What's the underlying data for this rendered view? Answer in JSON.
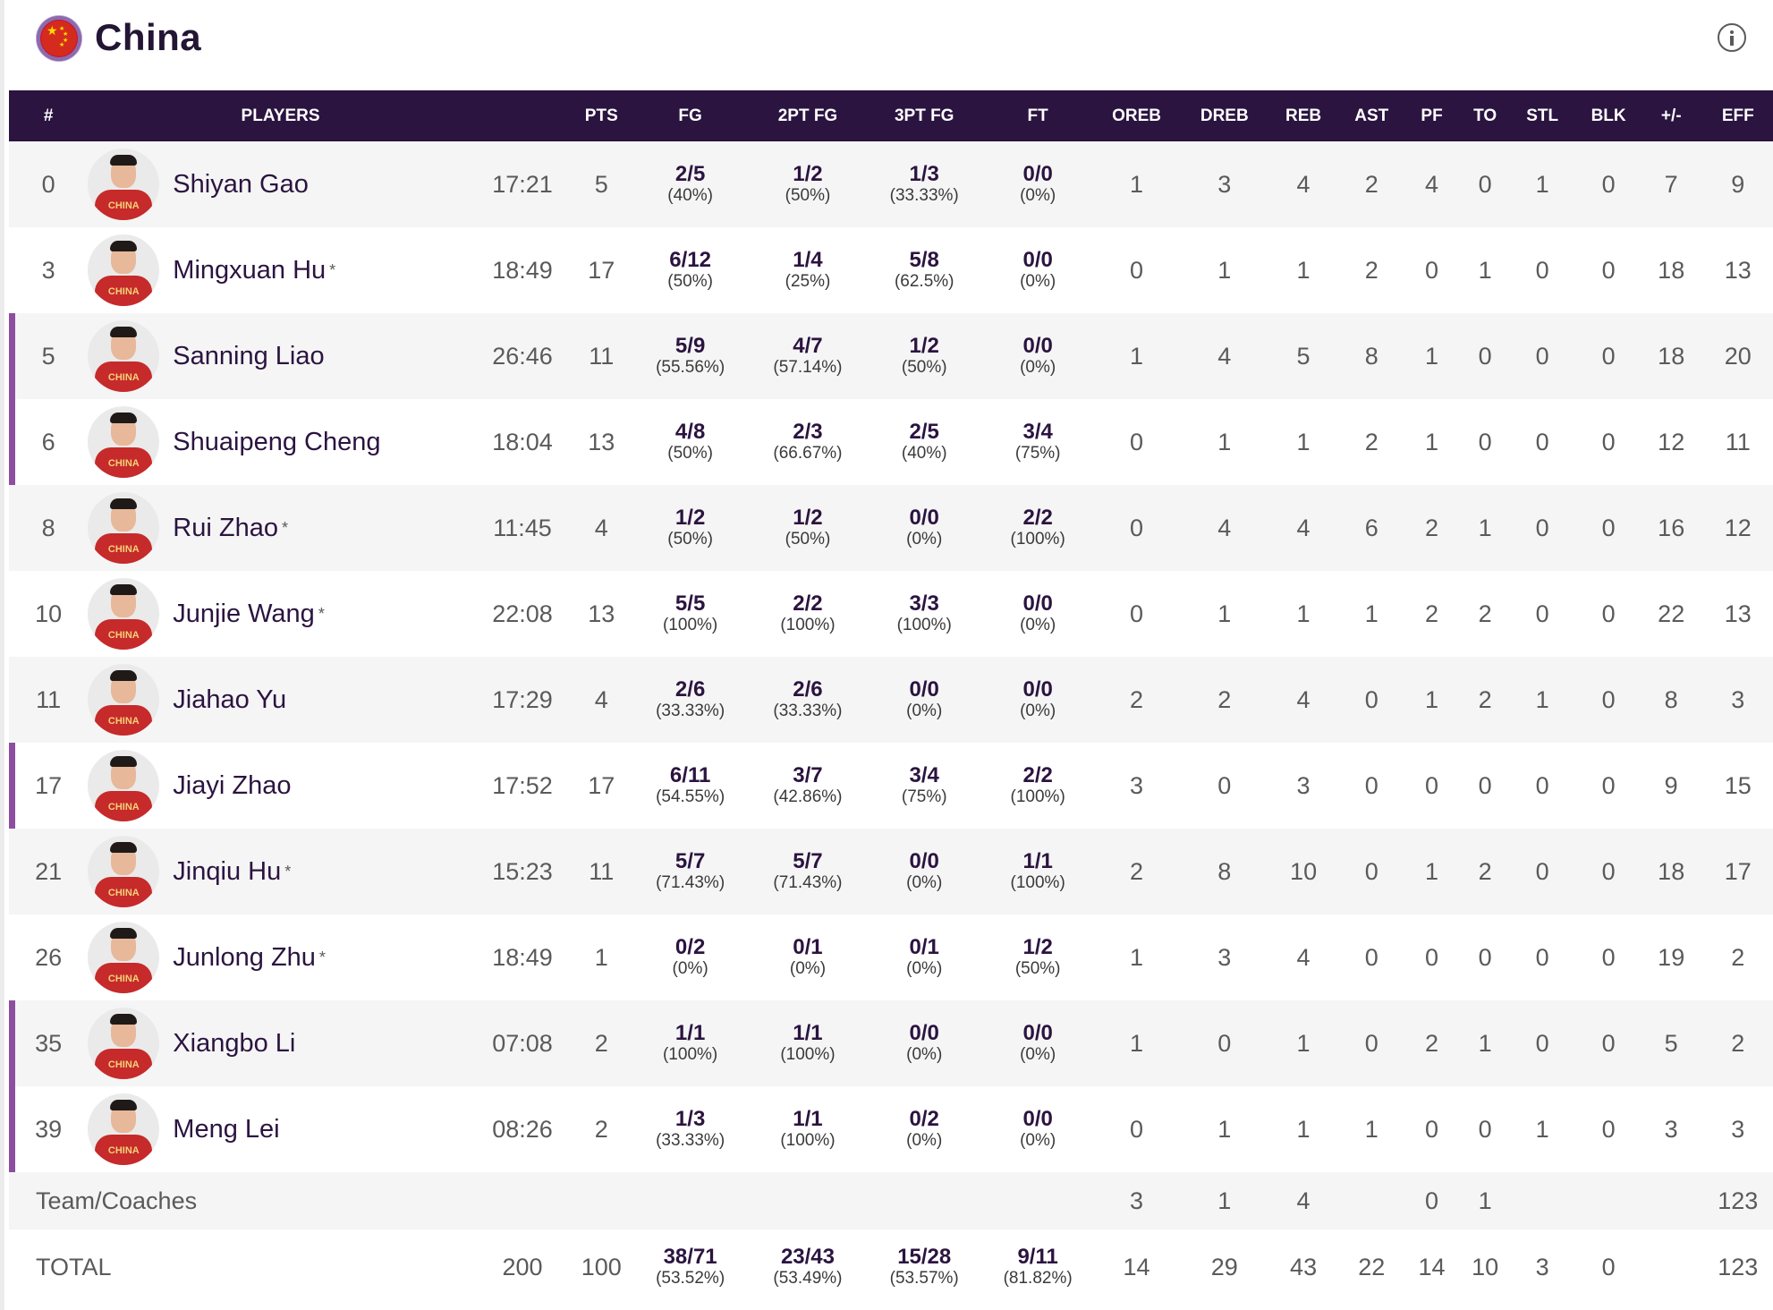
{
  "team": {
    "name": "China",
    "flag_icon": "china-flag-icon",
    "info_icon": "info-icon"
  },
  "columns": [
    "#",
    "PLAYERS",
    "",
    "PTS",
    "FG",
    "2PT FG",
    "3PT FG",
    "FT",
    "OREB",
    "DREB",
    "REB",
    "AST",
    "PF",
    "TO",
    "STL",
    "BLK",
    "+/-",
    "EFF"
  ],
  "players": [
    {
      "num": "0",
      "name": "Shiyan Gao",
      "star": "",
      "starter": false,
      "min": "17:21",
      "pts": "5",
      "fg": [
        "2/5",
        "(40%)"
      ],
      "fg2": [
        "1/2",
        "(50%)"
      ],
      "fg3": [
        "1/3",
        "(33.33%)"
      ],
      "ft": [
        "0/0",
        "(0%)"
      ],
      "oreb": "1",
      "dreb": "3",
      "reb": "4",
      "ast": "2",
      "pf": "4",
      "to": "0",
      "stl": "1",
      "blk": "0",
      "pm": "7",
      "eff": "9"
    },
    {
      "num": "3",
      "name": "Mingxuan Hu",
      "star": "*",
      "starter": false,
      "min": "18:49",
      "pts": "17",
      "fg": [
        "6/12",
        "(50%)"
      ],
      "fg2": [
        "1/4",
        "(25%)"
      ],
      "fg3": [
        "5/8",
        "(62.5%)"
      ],
      "ft": [
        "0/0",
        "(0%)"
      ],
      "oreb": "0",
      "dreb": "1",
      "reb": "1",
      "ast": "2",
      "pf": "0",
      "to": "1",
      "stl": "0",
      "blk": "0",
      "pm": "18",
      "eff": "13"
    },
    {
      "num": "5",
      "name": "Sanning Liao",
      "star": "",
      "starter": true,
      "min": "26:46",
      "pts": "11",
      "fg": [
        "5/9",
        "(55.56%)"
      ],
      "fg2": [
        "4/7",
        "(57.14%)"
      ],
      "fg3": [
        "1/2",
        "(50%)"
      ],
      "ft": [
        "0/0",
        "(0%)"
      ],
      "oreb": "1",
      "dreb": "4",
      "reb": "5",
      "ast": "8",
      "pf": "1",
      "to": "0",
      "stl": "0",
      "blk": "0",
      "pm": "18",
      "eff": "20"
    },
    {
      "num": "6",
      "name": "Shuaipeng Cheng",
      "star": "",
      "starter": true,
      "min": "18:04",
      "pts": "13",
      "fg": [
        "4/8",
        "(50%)"
      ],
      "fg2": [
        "2/3",
        "(66.67%)"
      ],
      "fg3": [
        "2/5",
        "(40%)"
      ],
      "ft": [
        "3/4",
        "(75%)"
      ],
      "oreb": "0",
      "dreb": "1",
      "reb": "1",
      "ast": "2",
      "pf": "1",
      "to": "0",
      "stl": "0",
      "blk": "0",
      "pm": "12",
      "eff": "11"
    },
    {
      "num": "8",
      "name": "Rui Zhao",
      "star": "*",
      "starter": false,
      "min": "11:45",
      "pts": "4",
      "fg": [
        "1/2",
        "(50%)"
      ],
      "fg2": [
        "1/2",
        "(50%)"
      ],
      "fg3": [
        "0/0",
        "(0%)"
      ],
      "ft": [
        "2/2",
        "(100%)"
      ],
      "oreb": "0",
      "dreb": "4",
      "reb": "4",
      "ast": "6",
      "pf": "2",
      "to": "1",
      "stl": "0",
      "blk": "0",
      "pm": "16",
      "eff": "12"
    },
    {
      "num": "10",
      "name": "Junjie Wang",
      "star": "*",
      "starter": false,
      "min": "22:08",
      "pts": "13",
      "fg": [
        "5/5",
        "(100%)"
      ],
      "fg2": [
        "2/2",
        "(100%)"
      ],
      "fg3": [
        "3/3",
        "(100%)"
      ],
      "ft": [
        "0/0",
        "(0%)"
      ],
      "oreb": "0",
      "dreb": "1",
      "reb": "1",
      "ast": "1",
      "pf": "2",
      "to": "2",
      "stl": "0",
      "blk": "0",
      "pm": "22",
      "eff": "13"
    },
    {
      "num": "11",
      "name": "Jiahao Yu",
      "star": "",
      "starter": false,
      "min": "17:29",
      "pts": "4",
      "fg": [
        "2/6",
        "(33.33%)"
      ],
      "fg2": [
        "2/6",
        "(33.33%)"
      ],
      "fg3": [
        "0/0",
        "(0%)"
      ],
      "ft": [
        "0/0",
        "(0%)"
      ],
      "oreb": "2",
      "dreb": "2",
      "reb": "4",
      "ast": "0",
      "pf": "1",
      "to": "2",
      "stl": "1",
      "blk": "0",
      "pm": "8",
      "eff": "3"
    },
    {
      "num": "17",
      "name": "Jiayi Zhao",
      "star": "",
      "starter": true,
      "min": "17:52",
      "pts": "17",
      "fg": [
        "6/11",
        "(54.55%)"
      ],
      "fg2": [
        "3/7",
        "(42.86%)"
      ],
      "fg3": [
        "3/4",
        "(75%)"
      ],
      "ft": [
        "2/2",
        "(100%)"
      ],
      "oreb": "3",
      "dreb": "0",
      "reb": "3",
      "ast": "0",
      "pf": "0",
      "to": "0",
      "stl": "0",
      "blk": "0",
      "pm": "9",
      "eff": "15"
    },
    {
      "num": "21",
      "name": "Jinqiu Hu",
      "star": "*",
      "starter": false,
      "min": "15:23",
      "pts": "11",
      "fg": [
        "5/7",
        "(71.43%)"
      ],
      "fg2": [
        "5/7",
        "(71.43%)"
      ],
      "fg3": [
        "0/0",
        "(0%)"
      ],
      "ft": [
        "1/1",
        "(100%)"
      ],
      "oreb": "2",
      "dreb": "8",
      "reb": "10",
      "ast": "0",
      "pf": "1",
      "to": "2",
      "stl": "0",
      "blk": "0",
      "pm": "18",
      "eff": "17"
    },
    {
      "num": "26",
      "name": "Junlong Zhu",
      "star": "*",
      "starter": false,
      "min": "18:49",
      "pts": "1",
      "fg": [
        "0/2",
        "(0%)"
      ],
      "fg2": [
        "0/1",
        "(0%)"
      ],
      "fg3": [
        "0/1",
        "(0%)"
      ],
      "ft": [
        "1/2",
        "(50%)"
      ],
      "oreb": "1",
      "dreb": "3",
      "reb": "4",
      "ast": "0",
      "pf": "0",
      "to": "0",
      "stl": "0",
      "blk": "0",
      "pm": "19",
      "eff": "2"
    },
    {
      "num": "35",
      "name": "Xiangbo Li",
      "star": "",
      "starter": true,
      "min": "07:08",
      "pts": "2",
      "fg": [
        "1/1",
        "(100%)"
      ],
      "fg2": [
        "1/1",
        "(100%)"
      ],
      "fg3": [
        "0/0",
        "(0%)"
      ],
      "ft": [
        "0/0",
        "(0%)"
      ],
      "oreb": "1",
      "dreb": "0",
      "reb": "1",
      "ast": "0",
      "pf": "2",
      "to": "1",
      "stl": "0",
      "blk": "0",
      "pm": "5",
      "eff": "2"
    },
    {
      "num": "39",
      "name": "Meng Lei",
      "star": "",
      "starter": true,
      "min": "08:26",
      "pts": "2",
      "fg": [
        "1/3",
        "(33.33%)"
      ],
      "fg2": [
        "1/1",
        "(100%)"
      ],
      "fg3": [
        "0/2",
        "(0%)"
      ],
      "ft": [
        "0/0",
        "(0%)"
      ],
      "oreb": "0",
      "dreb": "1",
      "reb": "1",
      "ast": "1",
      "pf": "0",
      "to": "0",
      "stl": "1",
      "blk": "0",
      "pm": "3",
      "eff": "3"
    }
  ],
  "team_row": {
    "label": "Team/Coaches",
    "oreb": "3",
    "dreb": "1",
    "reb": "4",
    "ast": "",
    "pf": "0",
    "to": "1",
    "stl": "",
    "blk": "",
    "pm": "",
    "eff": "123"
  },
  "total_row": {
    "label": "TOTAL",
    "min": "200",
    "pts": "100",
    "fg": [
      "38/71",
      "(53.52%)"
    ],
    "fg2": [
      "23/43",
      "(53.49%)"
    ],
    "fg3": [
      "15/28",
      "(53.57%)"
    ],
    "ft": [
      "9/11",
      "(81.82%)"
    ],
    "oreb": "14",
    "dreb": "29",
    "reb": "43",
    "ast": "22",
    "pf": "14",
    "to": "10",
    "stl": "3",
    "blk": "0",
    "pm": "",
    "eff": "123"
  },
  "jersey_text": "CHINA",
  "colors": {
    "header_bg": "#2b1440",
    "starter_bar": "#8d4ea0",
    "row_alt": "#f5f5f5"
  }
}
